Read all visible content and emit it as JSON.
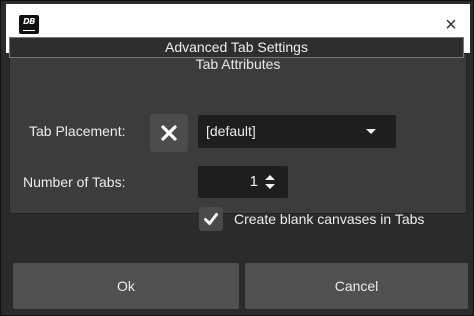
{
  "window": {
    "logo_text": "DB",
    "close_glyph": "×",
    "icon": "app-logo-icon"
  },
  "panel": {
    "title": "Tab Attributes"
  },
  "section": {
    "title": "Advanced Tab Settings"
  },
  "placement": {
    "label": "Tab Placement:",
    "clear_icon": "x-icon",
    "value": "[default]"
  },
  "tabs_count": {
    "label": "Number of Tabs:",
    "value": "1"
  },
  "blank_canvases": {
    "label": "Create blank canvases in Tabs",
    "checked": true
  },
  "buttons": {
    "ok": "Ok",
    "cancel": "Cancel"
  },
  "colors": {
    "background": "#2b2b2b",
    "panel": "#3c3c3c",
    "field": "#1e1e1e",
    "button": "#505050",
    "text": "#ececec"
  }
}
